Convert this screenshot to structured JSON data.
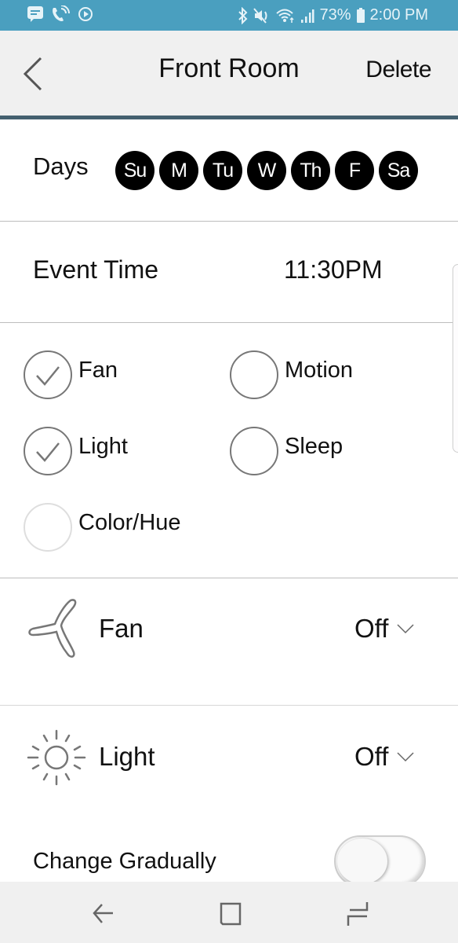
{
  "status_bar": {
    "left_icons": [
      "message-icon",
      "wifi-call-icon",
      "sync-icon"
    ],
    "right_icons": [
      "bluetooth-icon",
      "mute-icon",
      "wifi-icon",
      "signal-icon"
    ],
    "battery": "73%",
    "time": "2:00 PM",
    "color": "#4a9fbf"
  },
  "header": {
    "title": "Front Room",
    "back_icon": "chevron-left-icon",
    "delete_label": "Delete",
    "accent_line_color": "#44606f"
  },
  "days": {
    "label": "Days",
    "items": [
      {
        "label": "Su",
        "selected": true
      },
      {
        "label": "M",
        "selected": true
      },
      {
        "label": "Tu",
        "selected": true
      },
      {
        "label": "W",
        "selected": true
      },
      {
        "label": "Th",
        "selected": true
      },
      {
        "label": "F",
        "selected": true
      },
      {
        "label": "Sa",
        "selected": true
      }
    ]
  },
  "event_time": {
    "label": "Event Time",
    "value": "11:30PM"
  },
  "options": [
    {
      "label": "Fan",
      "checked": true
    },
    {
      "label": "Motion",
      "checked": false
    },
    {
      "label": "Light",
      "checked": true
    },
    {
      "label": "Sleep",
      "checked": false
    },
    {
      "label": "Color/Hue",
      "checked": false,
      "disabled": true
    }
  ],
  "controls": {
    "fan": {
      "label": "Fan",
      "value": "Off",
      "icon": "fan-icon"
    },
    "light": {
      "label": "Light",
      "value": "Off",
      "icon": "sun-icon"
    }
  },
  "change_gradually": {
    "label": "Change Gradually",
    "on": false
  },
  "nav_bar": {
    "buttons": [
      "back-nav",
      "home-nav",
      "recents-nav"
    ]
  }
}
